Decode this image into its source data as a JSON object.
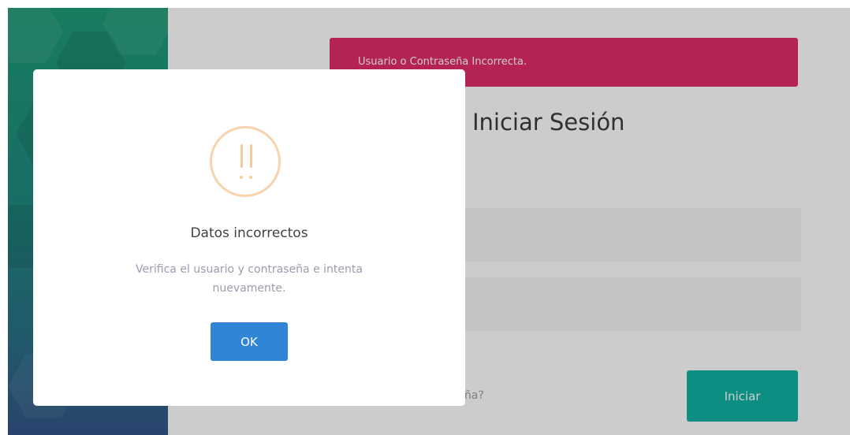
{
  "login": {
    "alert_text": "Usuario o Contraseña Incorrecta.",
    "title": "Iniciar Sesión",
    "forgot_text": "seña?",
    "submit_label": "Iniciar"
  },
  "dialog": {
    "icon": "warning-icon",
    "title": "Datos incorrectos",
    "message": "Verifica el usuario y contraseña e intenta nuevamente.",
    "confirm_label": "OK"
  },
  "colors": {
    "alert_bg": "#e22c6a",
    "primary_button": "#10b3a3",
    "dialog_button": "#3085d6",
    "warning_icon": "#f8c89b"
  }
}
